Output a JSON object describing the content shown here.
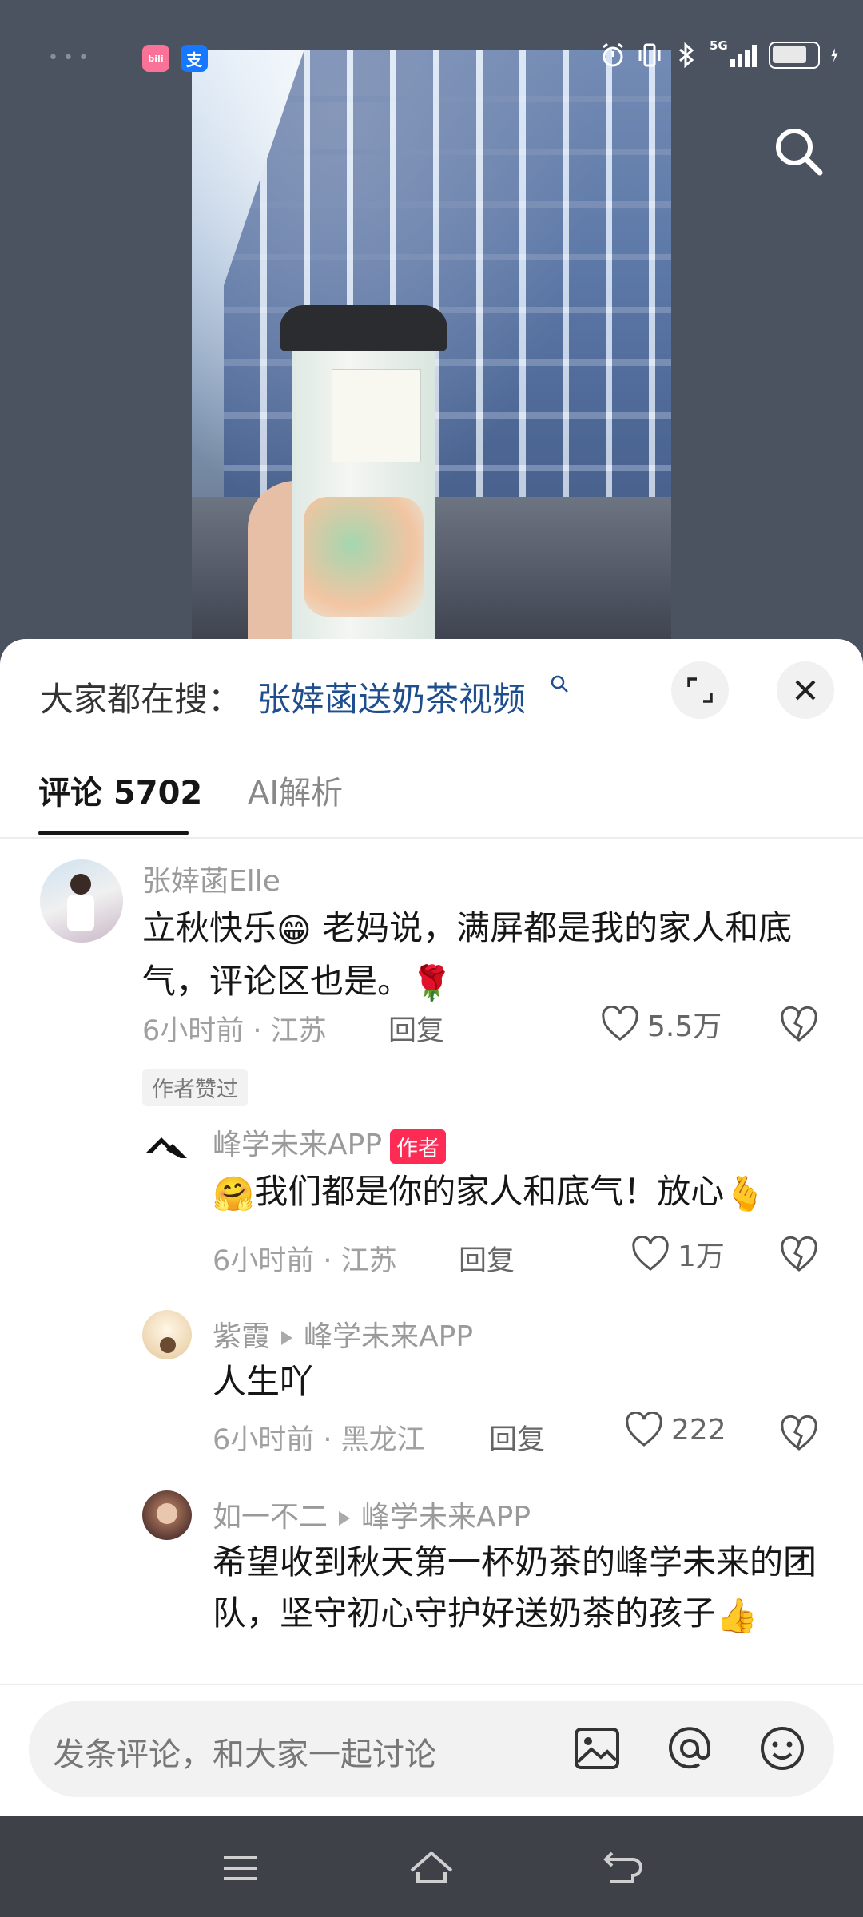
{
  "status_bar": {
    "bili_badge": "bili",
    "alipay_badge": "支",
    "network": "5G",
    "icons": [
      "alarm-icon",
      "vibrate-icon",
      "bluetooth-icon",
      "signal-icon",
      "battery-icon",
      "charging-icon"
    ]
  },
  "video": {
    "search_icon": "search-icon"
  },
  "suggest": {
    "prefix": "大家都在搜：",
    "link": "张婞菡送奶茶视频"
  },
  "tabs": {
    "comments": "评论 5702",
    "ai": "AI解析"
  },
  "comments": [
    {
      "author": "张婞菡Elle",
      "text_a": "立秋快乐",
      "emoji_a": "😁",
      "text_b": " 老妈说，满屏都是我的家人和底气，评论区也是。",
      "emoji_b": "🌹",
      "time_location": "6小时前 · 江苏",
      "reply": "回复",
      "likes": "5.5万",
      "liked_by_author": "作者赞过"
    },
    {
      "author": "峰学未来APP",
      "author_tag": "作者",
      "emoji_a": "🤗",
      "text": "我们都是你的家人和底气！放心",
      "emoji_b": "🫰",
      "time_location": "6小时前 · 江苏",
      "reply": "回复",
      "likes": "1万"
    },
    {
      "author": "紫霞",
      "reply_to": "峰学未来APP",
      "text": "人生吖",
      "time_location": "6小时前 · 黑龙江",
      "reply": "回复",
      "likes": "222"
    },
    {
      "author": "如一不二",
      "reply_to": "峰学未来APP",
      "text": "希望收到秋天第一杯奶茶的峰学未来的团队，坚守初心守护好送奶茶的孩子",
      "emoji": "👍"
    }
  ],
  "input": {
    "placeholder": "发条评论，和大家一起讨论"
  },
  "colors": {
    "accent_red": "#fe2c55",
    "link_blue": "#1f4e8f",
    "sheet_bg": "#ffffff",
    "nav_bg": "#3e4148"
  }
}
